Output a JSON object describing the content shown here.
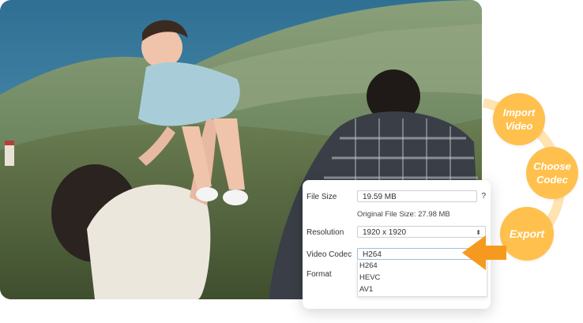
{
  "panel": {
    "file_size_label": "File Size",
    "file_size_value": "19.59  MB",
    "help_icon": "?",
    "original_size": "Original File Size: 27.98 MB",
    "resolution_label": "Resolution",
    "resolution_value": "1920 x 1920",
    "resolution_arrow": "⌃⌄",
    "video_codec_label": "Video Codec",
    "video_codec_value": "H264",
    "codec_options": [
      "H264",
      "HEVC",
      "AV1"
    ],
    "format_label": "Format"
  },
  "steps": {
    "import_video": "Import Video",
    "choose_codec": "Choose Codec",
    "export": "Export"
  },
  "colors": {
    "accent": "#ffc04d",
    "arrow": "#f59a1e",
    "step_ring": "#ffe3b0"
  },
  "icons": {
    "photo": "family-photo",
    "pointer": "arrow-pointer-icon",
    "help": "help-icon",
    "dropdown": "select-arrows-icon"
  }
}
